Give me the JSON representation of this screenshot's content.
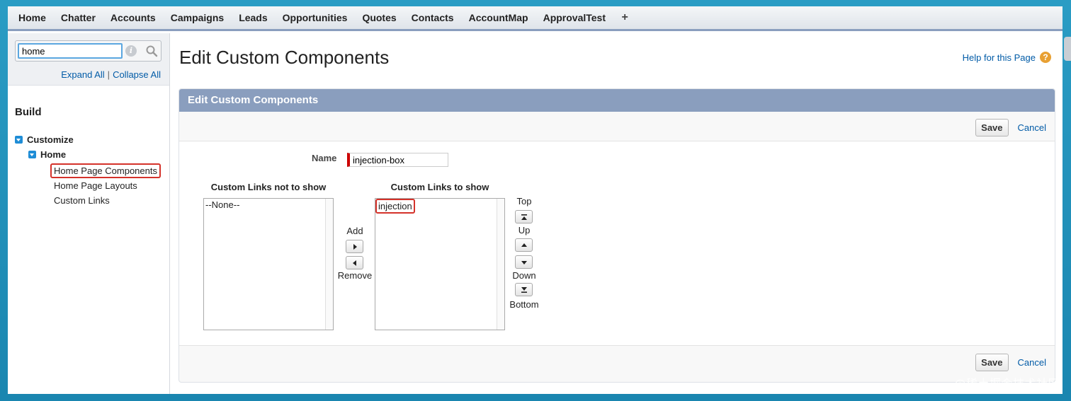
{
  "tabs": [
    "Home",
    "Chatter",
    "Accounts",
    "Campaigns",
    "Leads",
    "Opportunities",
    "Quotes",
    "Contacts",
    "AccountMap",
    "ApprovalTest"
  ],
  "tab_plus": "+",
  "sidebar": {
    "search_value": "home",
    "expand_all": "Expand All",
    "separator": "|",
    "collapse_all": "Collapse All",
    "build_heading": "Build",
    "customize": "Customize",
    "home": "Home",
    "leaves": [
      "Home Page Components",
      "Home Page Layouts",
      "Custom Links"
    ]
  },
  "main": {
    "page_title": "Edit Custom Components",
    "help_link": "Help for this Page",
    "panel_title": "Edit Custom Components",
    "save_label": "Save",
    "cancel_label": "Cancel",
    "name_label": "Name",
    "name_value": "injection-box",
    "not_show_title": "Custom Links not to show",
    "not_show_options": [
      "--None--"
    ],
    "show_title": "Custom Links to show",
    "show_options": [
      "injection"
    ],
    "add_label": "Add",
    "remove_label": "Remove",
    "top_label": "Top",
    "up_label": "Up",
    "down_label": "Down",
    "bottom_label": "Bottom"
  },
  "watermark": "@稀土掘金技术社区",
  "colors": {
    "tab_accent": "#8a9ebe",
    "link": "#015ba7",
    "highlight": "#d4322a",
    "required": "#cc0000",
    "help_icon": "#e8a033",
    "tree_toggle": "#1f8dd6"
  }
}
